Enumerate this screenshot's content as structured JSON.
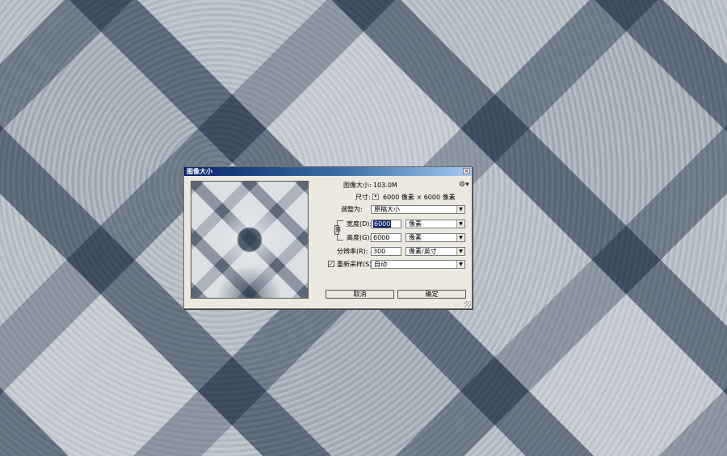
{
  "dialog": {
    "title": "图像大小",
    "close_glyph": "×",
    "image_size_label": "图像大小:",
    "image_size_value": "103.0M",
    "gear_icon": "gear-icon",
    "dimensions_label": "尺寸:",
    "dimensions_value": "6000 像素  ×  6000 像素",
    "fit_to_label": "调整为:",
    "fit_to_value": "原稿大小",
    "width_label": "宽度(D):",
    "width_value": "6000",
    "width_unit": "像素",
    "height_label": "高度(G):",
    "height_value": "6000",
    "height_unit": "像素",
    "resolution_label": "分辨率(R):",
    "resolution_value": "300",
    "resolution_unit": "像素/英寸",
    "resample_label": "重新采样(S):",
    "resample_checked": true,
    "resample_value": "自动",
    "cancel_label": "取消",
    "ok_label": "确定"
  },
  "colors": {
    "titlebar_start": "#0a246a",
    "titlebar_end": "#a6caf0",
    "dialog_bg": "#ece9e0"
  }
}
